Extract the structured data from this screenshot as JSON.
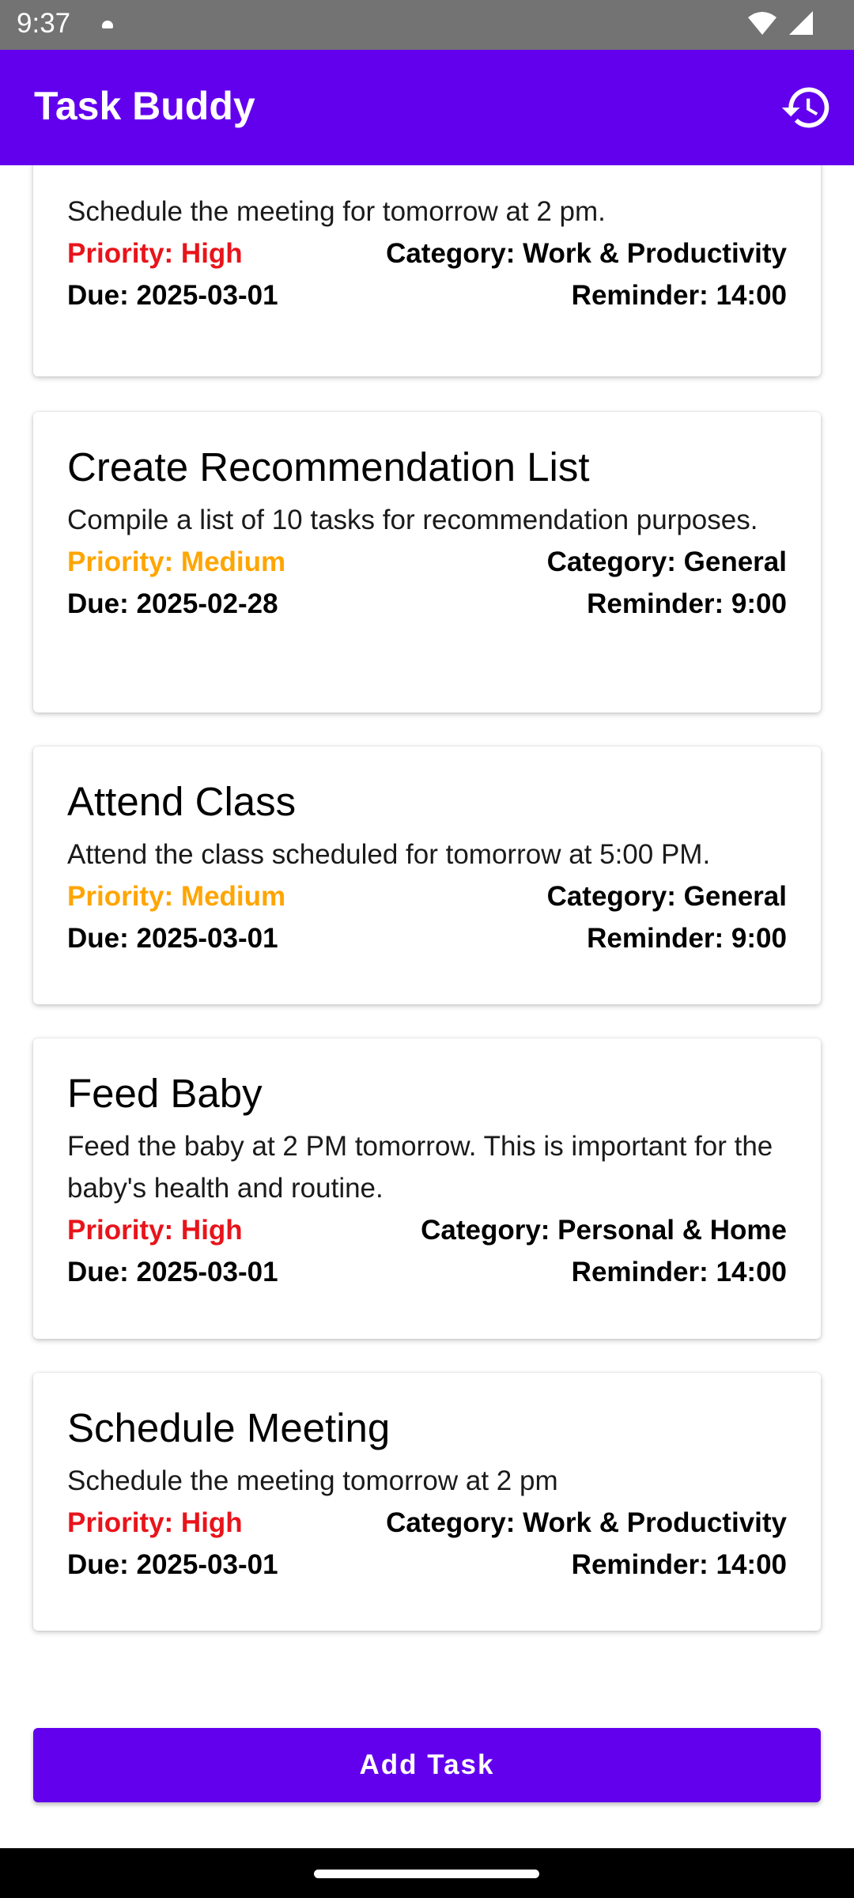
{
  "status_bar": {
    "time": "9:37"
  },
  "app_bar": {
    "title": "Task Buddy",
    "history_icon": "history-icon"
  },
  "colors": {
    "primary": "#6200ee",
    "priority_high": "#e8141b",
    "priority_medium": "#ffa500"
  },
  "tasks": [
    {
      "title": "",
      "description": "Schedule the meeting for tomorrow at 2 pm.",
      "priority": "Priority: High",
      "category": "Category: Work & Productivity",
      "due": "Due: 2025-03-01",
      "reminder": "Reminder: 14:00"
    },
    {
      "title": "Create Recommendation List",
      "description": "Compile a list of 10 tasks for recommendation purposes.",
      "priority": "Priority: Medium",
      "category": "Category: General",
      "due": "Due: 2025-02-28",
      "reminder": "Reminder: 9:00"
    },
    {
      "title": "Attend Class",
      "description": "Attend the class scheduled for tomorrow at 5:00 PM.",
      "priority": "Priority: Medium",
      "category": "Category: General",
      "due": "Due: 2025-03-01",
      "reminder": "Reminder: 9:00"
    },
    {
      "title": "Feed Baby",
      "description": "Feed the baby at 2 PM tomorrow. This is important for the baby's health and routine.",
      "priority": "Priority: High",
      "category": "Category: Personal & Home",
      "due": "Due: 2025-03-01",
      "reminder": "Reminder: 14:00"
    },
    {
      "title": "Schedule Meeting",
      "description": "Schedule the meeting tomorrow at 2 pm",
      "priority": "Priority: High",
      "category": "Category: Work & Productivity",
      "due": "Due: 2025-03-01",
      "reminder": "Reminder: 14:00"
    }
  ],
  "add_button": {
    "label": "Add Task"
  }
}
